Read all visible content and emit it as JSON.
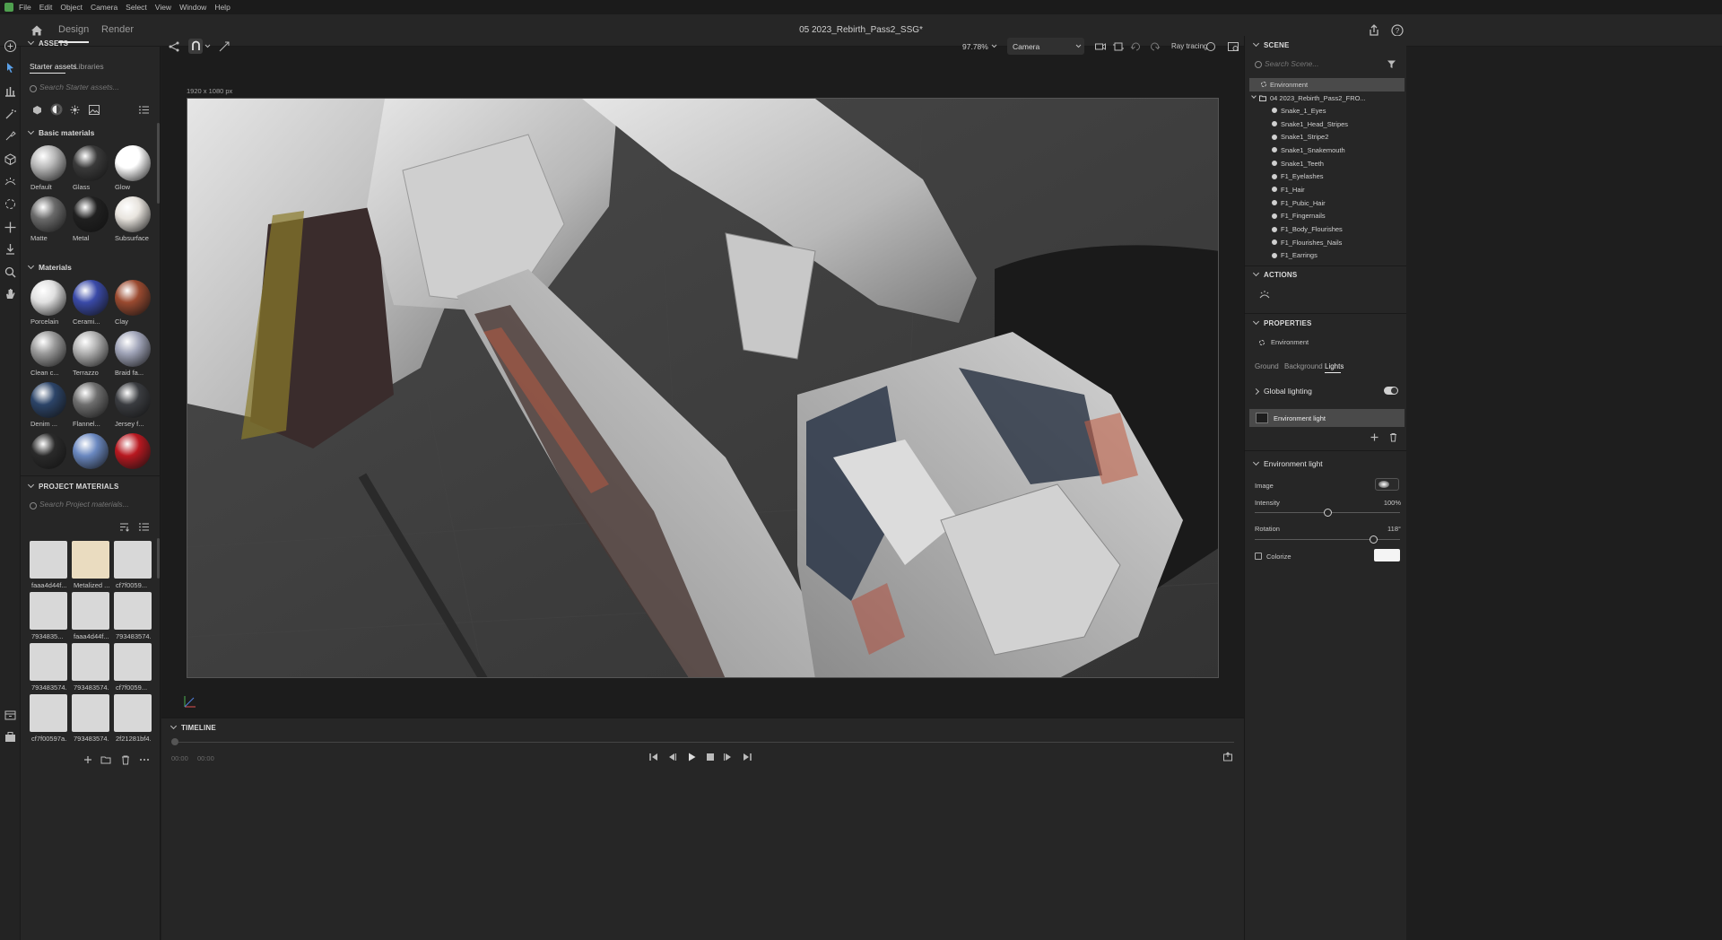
{
  "menu": {
    "items": [
      "File",
      "Edit",
      "Object",
      "Camera",
      "Select",
      "View",
      "Window",
      "Help"
    ]
  },
  "tabs": {
    "design": "Design",
    "render": "Render"
  },
  "document": {
    "title": "05 2023_Rebirth_Pass2_SSG*"
  },
  "viewport": {
    "zoom": "97.78%",
    "camera": "Camera",
    "ray_tracing": "Ray tracing",
    "frame_size": "1920 x 1080 px"
  },
  "assets": {
    "header": "ASSETS",
    "tabs": [
      "Starter assets",
      "Libraries"
    ],
    "search_placeholder": "Search Starter assets...",
    "basic_header": "Basic materials",
    "basic": [
      {
        "label": "Default",
        "color": "#b8b8b8"
      },
      {
        "label": "Glass",
        "color": "#3a3a3a"
      },
      {
        "label": "Glow",
        "color": "#ffffff"
      },
      {
        "label": "Matte",
        "color": "#6a6a6a"
      },
      {
        "label": "Metal",
        "color": "#202020"
      },
      {
        "label": "Subsurface",
        "color": "#e8e4de"
      }
    ],
    "materials_header": "Materials",
    "materials": [
      {
        "label": "Porcelain",
        "color": "#e0e0e0"
      },
      {
        "label": "Cerami...",
        "color": "#3a4aa8"
      },
      {
        "label": "Clay",
        "color": "#9a4a30"
      },
      {
        "label": "Clean c...",
        "color": "#9a9a9a"
      },
      {
        "label": "Terrazzo",
        "color": "#b0b0b0"
      },
      {
        "label": "Braid fa...",
        "color": "#a0a4b8"
      },
      {
        "label": "Denim ...",
        "color": "#2c4468"
      },
      {
        "label": "Flannel...",
        "color": "#6e6e6e"
      },
      {
        "label": "Jersey f...",
        "color": "#3a3c40"
      },
      {
        "label": "",
        "color": "#2a2a2a"
      },
      {
        "label": "",
        "color": "#6a88c0"
      },
      {
        "label": "",
        "color": "#b81820"
      }
    ],
    "project_header": "PROJECT MATERIALS",
    "project_search": "Search Project materials...",
    "project": [
      {
        "label": "faaa4d44f...",
        "color": "#d8d8d8"
      },
      {
        "label": "Metalized ...",
        "color": "#eadcc0"
      },
      {
        "label": "cf7f0059...",
        "color": "#d8d8d8"
      },
      {
        "label": "7934835...",
        "color": "#d8d8d8"
      },
      {
        "label": "faaa4d44f...",
        "color": "#d8d8d8"
      },
      {
        "label": "793483574...",
        "color": "#d8d8d8"
      },
      {
        "label": "793483574...",
        "color": "#d8d8d8"
      },
      {
        "label": "793483574...",
        "color": "#d8d8d8"
      },
      {
        "label": "cf7f0059...",
        "color": "#d8d8d8"
      },
      {
        "label": "cf7f00597a...",
        "color": "#d8d8d8"
      },
      {
        "label": "793483574...",
        "color": "#d8d8d8"
      },
      {
        "label": "2f21281bf4...",
        "color": "#d8d8d8"
      }
    ]
  },
  "scene": {
    "header": "SCENE",
    "search_placeholder": "Search Scene...",
    "environment": "Environment",
    "group": "04 2023_Rebirth_Pass2_FRO...",
    "items": [
      "Snake_1_Eyes",
      "Snake1_Head_Stripes",
      "Snake1_Stripe2",
      "Snake1_Snakemouth",
      "Snake1_Teeth",
      "F1_Eyelashes",
      "F1_Hair",
      "F1_Pubic_Hair",
      "F1_Fingernails",
      "F1_Body_Flourishes",
      "F1_Flourishes_Nails",
      "F1_Earrings"
    ]
  },
  "actions": {
    "header": "ACTIONS"
  },
  "properties": {
    "header": "PROPERTIES",
    "target": "Environment",
    "tabs": [
      "Ground",
      "Background",
      "Lights"
    ],
    "global_lighting": "Global lighting",
    "env_light_item": "Environment light",
    "env_light_header": "Environment light",
    "image_label": "Image",
    "intensity_label": "Intensity",
    "intensity_value": "100%",
    "intensity_level": 0.5,
    "rotation_label": "Rotation",
    "rotation_value": "118°",
    "rotation_level": 0.82,
    "colorize_label": "Colorize"
  },
  "timeline": {
    "header": "TIMELINE",
    "time_start": "00:00",
    "time_end": "00:00"
  }
}
